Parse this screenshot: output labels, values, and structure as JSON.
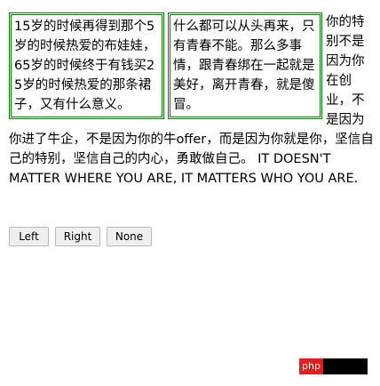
{
  "floats": {
    "box1_text": "15岁的时候再得到那个5岁的时候热爱的布娃娃，65岁的时候终于有钱买25岁的时候热爱的那条裙子，又有什么意义。",
    "box2_text": "什么都可以从头再来，只有青春不能。那么多事情，跟青春绑在一起就是美好，离开青春，就是傻冒。"
  },
  "paragraph": {
    "chinese": "你的特别不是因为你在创业，不是因为你进了牛企，不是因为你的牛offer，而是因为你就是你，坚信自己的特别，坚信自己的内心，勇敢做自己。",
    "english": "IT DOESN'T MATTER WHERE YOU ARE, IT MATTERS WHO YOU ARE."
  },
  "buttons": {
    "left": "Left",
    "right": "Right",
    "none": "None"
  },
  "watermark": {
    "text": "php"
  }
}
